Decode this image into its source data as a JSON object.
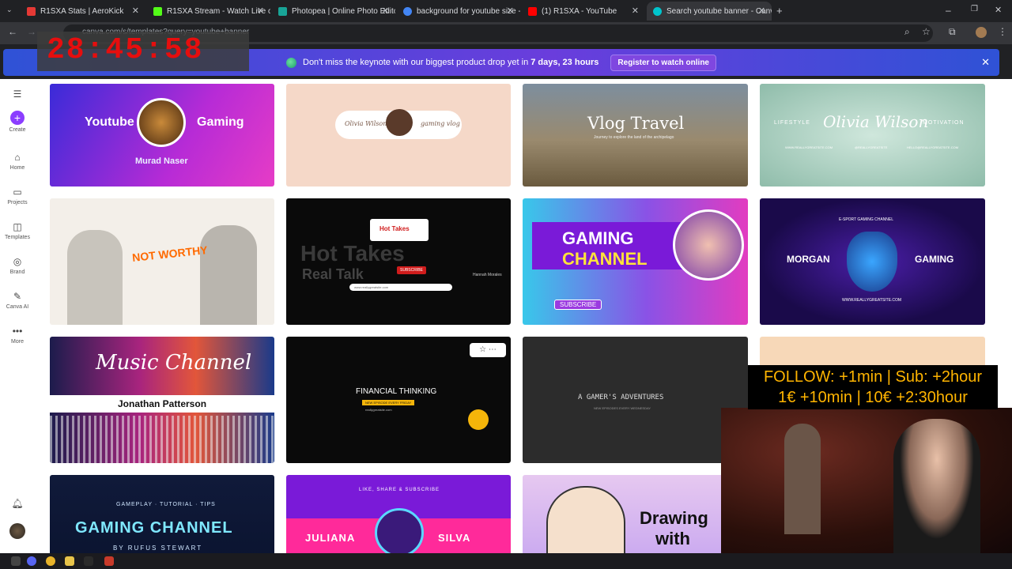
{
  "browser": {
    "tabs": [
      {
        "title": "R1SXA Stats | AeroKick",
        "color": "#e53935"
      },
      {
        "title": "R1SXA Stream - Watch Live on",
        "color": "#53fc18"
      },
      {
        "title": "Photopea | Online Photo Editor",
        "color": "#18a497"
      },
      {
        "title": "background for youtube size -",
        "color": "#4285f4"
      },
      {
        "title": "(1) R1SXA - YouTube",
        "color": "#ff0000"
      },
      {
        "title": "Search youtube banner - Canva",
        "color": "#00c4cc"
      }
    ],
    "url": "canva.com/s/templates?query=youtube+banner"
  },
  "timer": "28:45:58",
  "banner": {
    "pre": "Don't miss the keynote with our biggest product drop yet in",
    "bold": "7 days, 23 hours",
    "button": "Register to watch online"
  },
  "sidebar": [
    {
      "label": "Create",
      "icon": "plus-icon"
    },
    {
      "label": "Home",
      "icon": "home-icon"
    },
    {
      "label": "Projects",
      "icon": "folder-icon"
    },
    {
      "label": "Templates",
      "icon": "templates-icon"
    },
    {
      "label": "Brand",
      "icon": "brand-icon"
    },
    {
      "label": "Canva AI",
      "icon": "ai-icon"
    },
    {
      "label": "More",
      "icon": "more-icon"
    }
  ],
  "templates": {
    "t1": {
      "left": "Youtube",
      "right": "Gaming",
      "name": "Murad Naser"
    },
    "t2": {
      "name": "Olivia Wilson",
      "tag": "gaming vlog"
    },
    "t3": {
      "title": "Vlog Travel",
      "sub": "Journey to explore the land of the archipelago"
    },
    "t4": {
      "left": "LIFESTYLE",
      "name": "Olivia Wilson",
      "right": "MOTIVATION",
      "s1": "WWW.REALLYGREATSITE.COM",
      "s2": "@REALLYGREATSITE",
      "s3": "HELLO@REALLYGREATSITE.COM"
    },
    "t5": {
      "title": "NOT WORTHY"
    },
    "t6": {
      "logo": "Hot Takes",
      "title1": "Hot Takes",
      "title2": "Real Talk",
      "subscribe": "SUBSCRIBE",
      "host": "Hannah Morales",
      "url": "www.reallygreatsite.com"
    },
    "t7": {
      "l1": "GAMING",
      "l2": "CHANNEL",
      "subscribe": "SUBSCRIBE"
    },
    "t8": {
      "top": "E-SPORT GAMING CHANNEL",
      "left": "MORGAN",
      "right": "GAMING",
      "url": "WWW.REALLYGREATSITE.COM"
    },
    "t9": {
      "title": "Music Channel",
      "name": "Jonathan Patterson"
    },
    "t10": {
      "title": "FINANCIAL THINKING",
      "sub": "NEW EPISODE EVERY FRIDAY",
      "url": "reallygreatsite.com"
    },
    "t11": {
      "title": "A GAMER'S ADVENTURES",
      "sub": "NEW EPISODES EVERY WEDNESDAY"
    },
    "t13": {
      "top": "GAMEPLAY · TUTORIAL · TIPS",
      "title": "GAMING CHANNEL",
      "by": "BY RUFUS STEWART"
    },
    "t14": {
      "top": "LIKE, SHARE & SUBSCRIBE",
      "left": "JULIANA",
      "right": "SILVA"
    },
    "t15": {
      "l1": "Drawing",
      "l2": "with"
    }
  },
  "overlay": {
    "line1": "FOLLOW: +1min | Sub: +2hour",
    "line2": "1€ +10min | 10€ +2:30hour"
  }
}
